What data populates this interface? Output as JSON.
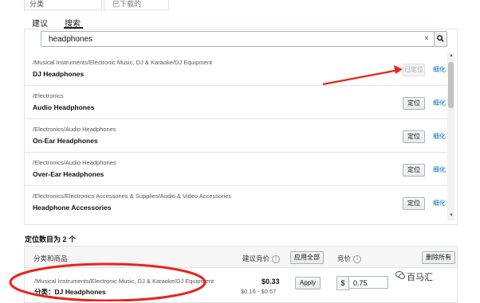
{
  "top_tabs": [
    {
      "label": "分类"
    },
    {
      "label": "已下载的"
    }
  ],
  "sub_tabs": [
    {
      "label": "建议"
    },
    {
      "label": "搜索"
    }
  ],
  "search": {
    "value": "headphones",
    "clear": "×"
  },
  "results": [
    {
      "path": "/Musical Instruments/Electronic Music, DJ & Karaoke/DJ Equipment",
      "name": "DJ Headphones",
      "button": "已定位",
      "disabled": true,
      "refine": "细化"
    },
    {
      "path": "/Electronics",
      "name": "Audio Headphones",
      "button": "定位",
      "disabled": false,
      "refine": "细化"
    },
    {
      "path": "/Electronics/Audio Headphones",
      "name": "On-Ear Headphones",
      "button": "定位",
      "disabled": false,
      "refine": "细化"
    },
    {
      "path": "/Electronics/Audio Headphones",
      "name": "Over-Ear Headphones",
      "button": "定位",
      "disabled": false,
      "refine": "细化"
    },
    {
      "path": "/Electronics/Electronics Accessories & Supplies/Audio & Video Accessories",
      "name": "Headphone Accessories",
      "button": "定位",
      "disabled": false,
      "refine": "细化"
    }
  ],
  "targets": {
    "count_label": "定位数目为 2 个",
    "headers": {
      "category": "分类和商品",
      "suggested_bid": "建议竞价",
      "apply_all": "应用全部",
      "bid": "竞价",
      "remove_all": "删除所有"
    },
    "row": {
      "path": "/Musical Instruments/Electronic Music, DJ & Karaoke/DJ Equipment",
      "name": "分类：DJ Headphones",
      "bid": "$0.33",
      "bid_range": "$0.16 - $0.57",
      "apply": "Apply",
      "currency": "$",
      "bid_value": "0.75"
    }
  },
  "watermark": "百马汇",
  "colors": {
    "annotation": "#e8241c",
    "link": "#0066c0"
  }
}
